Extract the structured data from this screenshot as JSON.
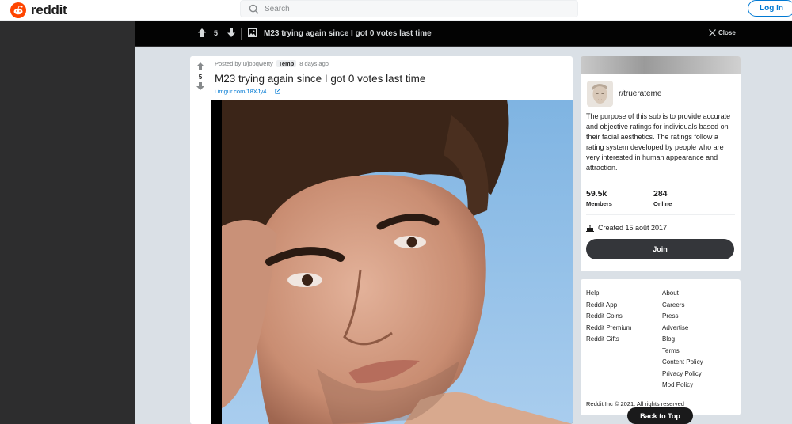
{
  "header": {
    "logo_text": "reddit",
    "search_placeholder": "Search",
    "login_label": "Log In"
  },
  "postbar": {
    "score": "5",
    "title": "M23 trying again since I got 0 votes last time",
    "close_label": "Close"
  },
  "post": {
    "score": "5",
    "posted_by": "Posted by u/jopqwerty",
    "flair": "Temp",
    "age": "8 days ago",
    "title": "M23 trying again since I got 0 votes last time",
    "link": "i.imgur.com/18XJy4..."
  },
  "subreddit": {
    "name": "r/truerateme",
    "description": "The purpose of this sub is to provide accurate and objective ratings for individuals based on their facial aesthetics. The ratings follow a rating system developed by people who are very interested in human appearance and attraction.",
    "members_count": "59.5k",
    "members_label": "Members",
    "online_count": "284",
    "online_label": "Online",
    "created": "Created 15 août 2017",
    "join_label": "Join"
  },
  "footer_links": {
    "col1": [
      "Help",
      "Reddit App",
      "Reddit Coins",
      "Reddit Premium",
      "Reddit Gifts"
    ],
    "col2": [
      "About",
      "Careers",
      "Press",
      "Advertise",
      "Blog",
      "Terms",
      "Content Policy",
      "Privacy Policy",
      "Mod Policy"
    ],
    "copyright": "Reddit Inc © 2021. All rights reserved",
    "back_to_top": "Back to Top"
  },
  "colors": {
    "brand": "#ff4500",
    "link": "#0079d3",
    "dark_bar": "#030303",
    "page_bg": "#dae0e6"
  }
}
